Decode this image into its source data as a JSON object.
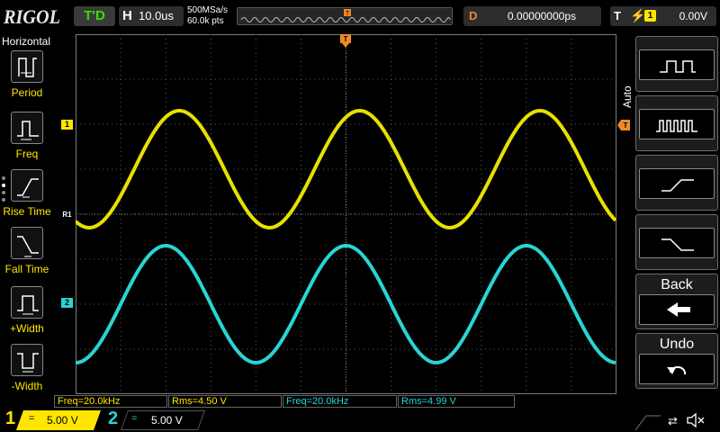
{
  "topbar": {
    "logo": "RIGOL",
    "run_state": "T'D",
    "horizontal": {
      "label": "H",
      "value": "10.0us"
    },
    "sample_rate": "500MSa/s",
    "memory_depth": "60.0k pts",
    "delay": {
      "label": "D",
      "value": "0.00000000ps"
    },
    "trigger": {
      "label": "T",
      "source": "1",
      "level": "0.00V"
    }
  },
  "left_menu": {
    "title": "Horizontal",
    "items": [
      {
        "label": "Period",
        "icon": "period-icon"
      },
      {
        "label": "Freq",
        "icon": "frequency-icon"
      },
      {
        "label": "Rise Time",
        "icon": "rise-time-icon"
      },
      {
        "label": "Fall Time",
        "icon": "fall-time-icon"
      },
      {
        "label": "+Width",
        "icon": "positive-width-icon"
      },
      {
        "label": "-Width",
        "icon": "negative-width-icon"
      }
    ]
  },
  "markers": {
    "ch1": "1",
    "ch2": "2",
    "ref": "R1"
  },
  "measurements": [
    {
      "text": "Freq=20.0kHz",
      "color": "#ffe600"
    },
    {
      "text": "Rms=4.50 V",
      "color": "#ffe600"
    },
    {
      "text": "Freq=20.0kHz",
      "color": "#2ad4d4"
    },
    {
      "text": "Rms=4.99 V",
      "color": "#2ad4d4"
    }
  ],
  "right_menu": {
    "auto_label": "Auto",
    "buttons": [
      {
        "name": "measure-all-button",
        "icon": "square-wave-icon"
      },
      {
        "name": "measure-burst-button",
        "icon": "pulse-train-icon"
      },
      {
        "name": "rising-edge-button",
        "icon": "rising-edge-icon"
      },
      {
        "name": "falling-edge-button",
        "icon": "falling-edge-icon"
      },
      {
        "name": "back-button",
        "label": "Back",
        "icon": "left-arrow-icon"
      },
      {
        "name": "undo-button",
        "label": "Undo",
        "icon": "undo-icon"
      }
    ]
  },
  "channels": [
    {
      "number": "1",
      "coupling": "=",
      "scale": "5.00 V",
      "color": "#ffe600"
    },
    {
      "number": "2",
      "coupling": "=",
      "scale": "5.00 V",
      "color": "#2ad4d4"
    }
  ],
  "waveforms": {
    "ch1": {
      "color": "#e8e000",
      "center_div": 1.0,
      "amplitude_div": 1.3,
      "period_div": 4.0,
      "peak_at_div": 2.3
    },
    "ch2": {
      "color": "#2ad4d4",
      "center_div": -2.0,
      "amplitude_div": 1.3,
      "period_div": 4.0,
      "peak_at_div": 2.0
    }
  },
  "colors": {
    "ch1": "#ffe600",
    "ch2": "#2ad4d4",
    "delay": "#f08a24",
    "run_state": "#35e000"
  }
}
